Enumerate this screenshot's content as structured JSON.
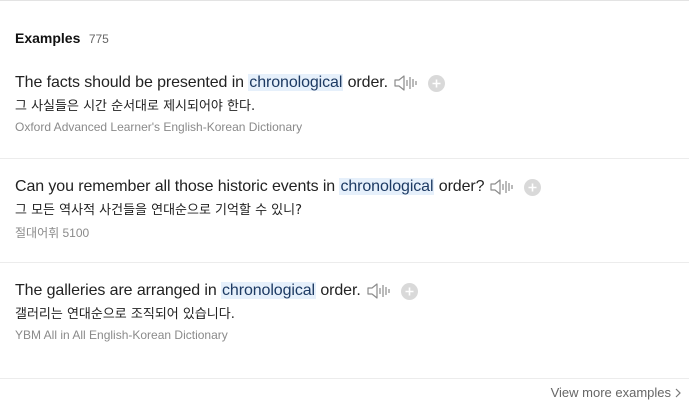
{
  "header": {
    "title": "Examples",
    "count": "775"
  },
  "examples": [
    {
      "before": "The facts should be presented in ",
      "highlight": "chronological",
      "after": " order.",
      "translation": "그 사실들은 시간 순서대로 제시되어야 한다.",
      "source": "Oxford Advanced Learner's English-Korean Dictionary"
    },
    {
      "before": "Can you remember all those historic events in ",
      "highlight": "chronological",
      "after": " order?",
      "translation": "그 모든 역사적 사건들을 연대순으로 기억할 수 있니?",
      "source": "절대어휘 5100"
    },
    {
      "before": "The galleries are arranged in ",
      "highlight": "chronological",
      "after": " order.",
      "translation": "갤러리는 연대순으로 조직되어 있습니다.",
      "source": "YBM All in All English-Korean Dictionary"
    }
  ],
  "footer": {
    "view_more": "View more examples"
  },
  "icons": {
    "speaker": "speaker-icon",
    "add": "plus-icon",
    "chevron": "chevron-right-icon"
  },
  "colors": {
    "highlight_bg": "#e6f0fb",
    "source_text": "#8a8a8a",
    "plus_bg": "#d9d9d9"
  }
}
